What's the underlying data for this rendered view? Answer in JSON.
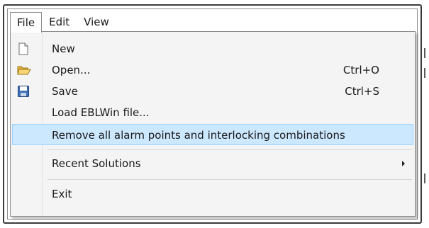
{
  "menubar": {
    "items": [
      {
        "label": "File"
      },
      {
        "label": "Edit"
      },
      {
        "label": "View"
      }
    ]
  },
  "file_menu": {
    "items": [
      {
        "label": "New",
        "shortcut": "",
        "icon": "new-file-icon"
      },
      {
        "label": "Open...",
        "shortcut": "Ctrl+O",
        "icon": "open-folder-icon"
      },
      {
        "label": "Save",
        "shortcut": "Ctrl+S",
        "icon": "save-disk-icon"
      },
      {
        "label": "Load EBLWin file...",
        "shortcut": ""
      },
      {
        "label": "Remove all alarm points and interlocking combinations",
        "shortcut": "",
        "highlighted": true
      },
      {
        "label": "Recent Solutions",
        "shortcut": "",
        "submenu": true
      },
      {
        "label": "Exit",
        "shortcut": ""
      }
    ]
  },
  "colors": {
    "highlight_bg": "#cce8ff",
    "highlight_border": "#99d1ff",
    "menu_bg": "#f4f4f4"
  }
}
